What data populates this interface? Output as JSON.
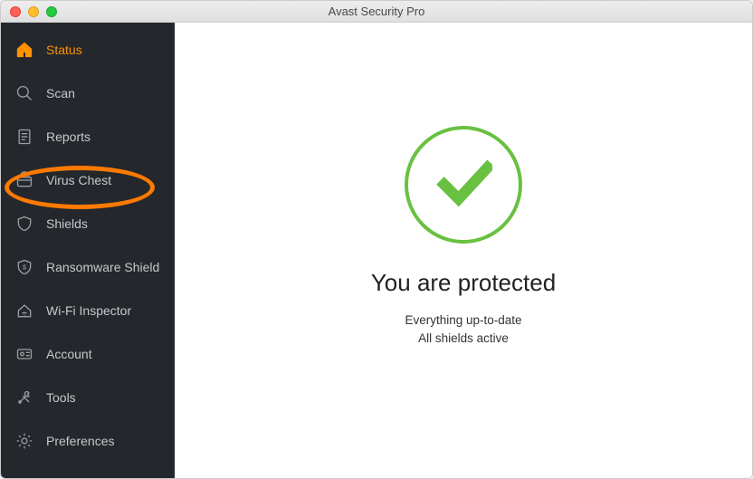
{
  "window": {
    "title": "Avast Security Pro"
  },
  "sidebar": {
    "items": [
      {
        "id": "status",
        "label": "Status",
        "active": true
      },
      {
        "id": "scan",
        "label": "Scan",
        "active": false
      },
      {
        "id": "reports",
        "label": "Reports",
        "active": false
      },
      {
        "id": "virus-chest",
        "label": "Virus Chest",
        "active": false,
        "highlighted": true
      },
      {
        "id": "shields",
        "label": "Shields",
        "active": false
      },
      {
        "id": "ransomware-shield",
        "label": "Ransomware Shield",
        "active": false
      },
      {
        "id": "wifi-inspector",
        "label": "Wi-Fi Inspector",
        "active": false
      },
      {
        "id": "account",
        "label": "Account",
        "active": false
      },
      {
        "id": "tools",
        "label": "Tools",
        "active": false
      },
      {
        "id": "preferences",
        "label": "Preferences",
        "active": false
      }
    ]
  },
  "main": {
    "status_heading": "You are protected",
    "status_line1": "Everything up-to-date",
    "status_line2": "All shields active"
  },
  "colors": {
    "accent": "#ff9100",
    "sidebar_bg": "#24282d",
    "success": "#68c140",
    "highlight": "#ff7a00"
  }
}
